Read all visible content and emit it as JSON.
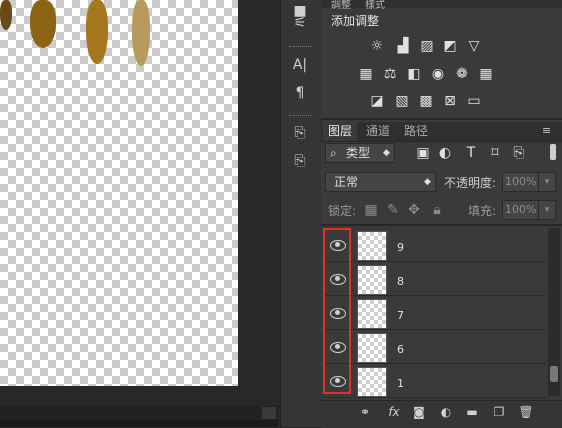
{
  "adjustments": {
    "tab_labels": [
      "調整",
      "樣式"
    ],
    "title": "添加调整",
    "row1_icons": [
      "brightness-icon",
      "levels-icon",
      "curves-icon",
      "exposure-icon",
      "vibrance-icon"
    ],
    "row2_icons": [
      "hue-saturation-icon",
      "color-balance-icon",
      "black-white-icon",
      "photo-filter-icon",
      "channel-mixer-icon",
      "color-lookup-icon"
    ],
    "row3_icons": [
      "invert-icon",
      "posterize-icon",
      "threshold-icon",
      "selective-color-icon",
      "gradient-map-icon"
    ]
  },
  "layers_panel": {
    "tabs": [
      "图层",
      "通道",
      "路径"
    ],
    "filter_label": "类型",
    "blend_mode": "正常",
    "opacity_label": "不透明度:",
    "opacity_value": "100%",
    "lock_label": "锁定:",
    "fill_label": "填充:",
    "fill_value": "100%",
    "layers": [
      {
        "name": "9",
        "visible": true
      },
      {
        "name": "8",
        "visible": true
      },
      {
        "name": "7",
        "visible": true
      },
      {
        "name": "6",
        "visible": true
      },
      {
        "name": "1",
        "visible": true
      }
    ]
  },
  "colors": {
    "highlight_box": "#e0302a",
    "panel_bg": "#3a3a3a"
  }
}
